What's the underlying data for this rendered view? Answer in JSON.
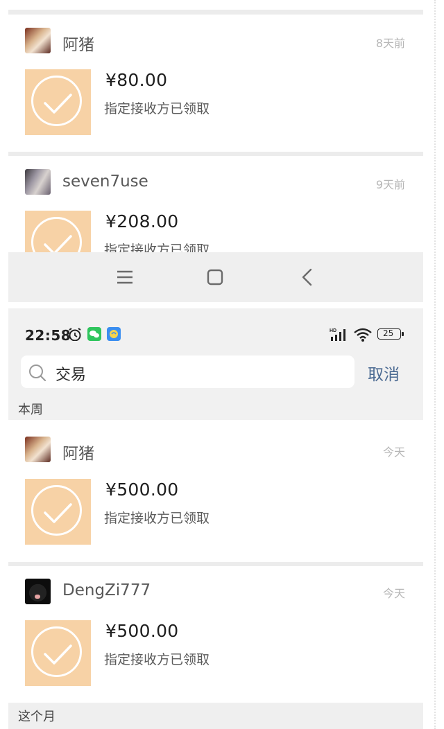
{
  "transactions_top": [
    {
      "name": "阿猪",
      "time": "8天前",
      "amount": "¥80.00",
      "status": "指定接收方已领取"
    },
    {
      "name": "seven7use",
      "time": "9天前",
      "amount": "¥208.00",
      "status": "指定接收方已领取"
    }
  ],
  "status_bar": {
    "clock": "22:58",
    "battery": "25"
  },
  "search": {
    "query": "交易",
    "cancel": "取消"
  },
  "sections": {
    "this_week": "本周",
    "this_month": "这个月"
  },
  "transactions_week": [
    {
      "name": "阿猪",
      "time": "今天",
      "amount": "¥500.00",
      "status": "指定接收方已领取"
    },
    {
      "name": "DengZi777",
      "time": "今天",
      "amount": "¥500.00",
      "status": "指定接收方已领取"
    }
  ],
  "icons": {
    "alarm": "alarm-icon",
    "wechat": "wechat-icon",
    "app": "app-notification-icon",
    "signal": "signal-icon",
    "wifi": "wifi-icon",
    "battery": "battery-icon",
    "menu": "menu-icon",
    "home": "home-icon",
    "back": "back-icon",
    "search": "search-icon",
    "check": "check-circle-icon"
  },
  "colors": {
    "tile": "#f7d2a6",
    "cancel": "#4b6a92",
    "wechat_green": "#2fc55d"
  }
}
